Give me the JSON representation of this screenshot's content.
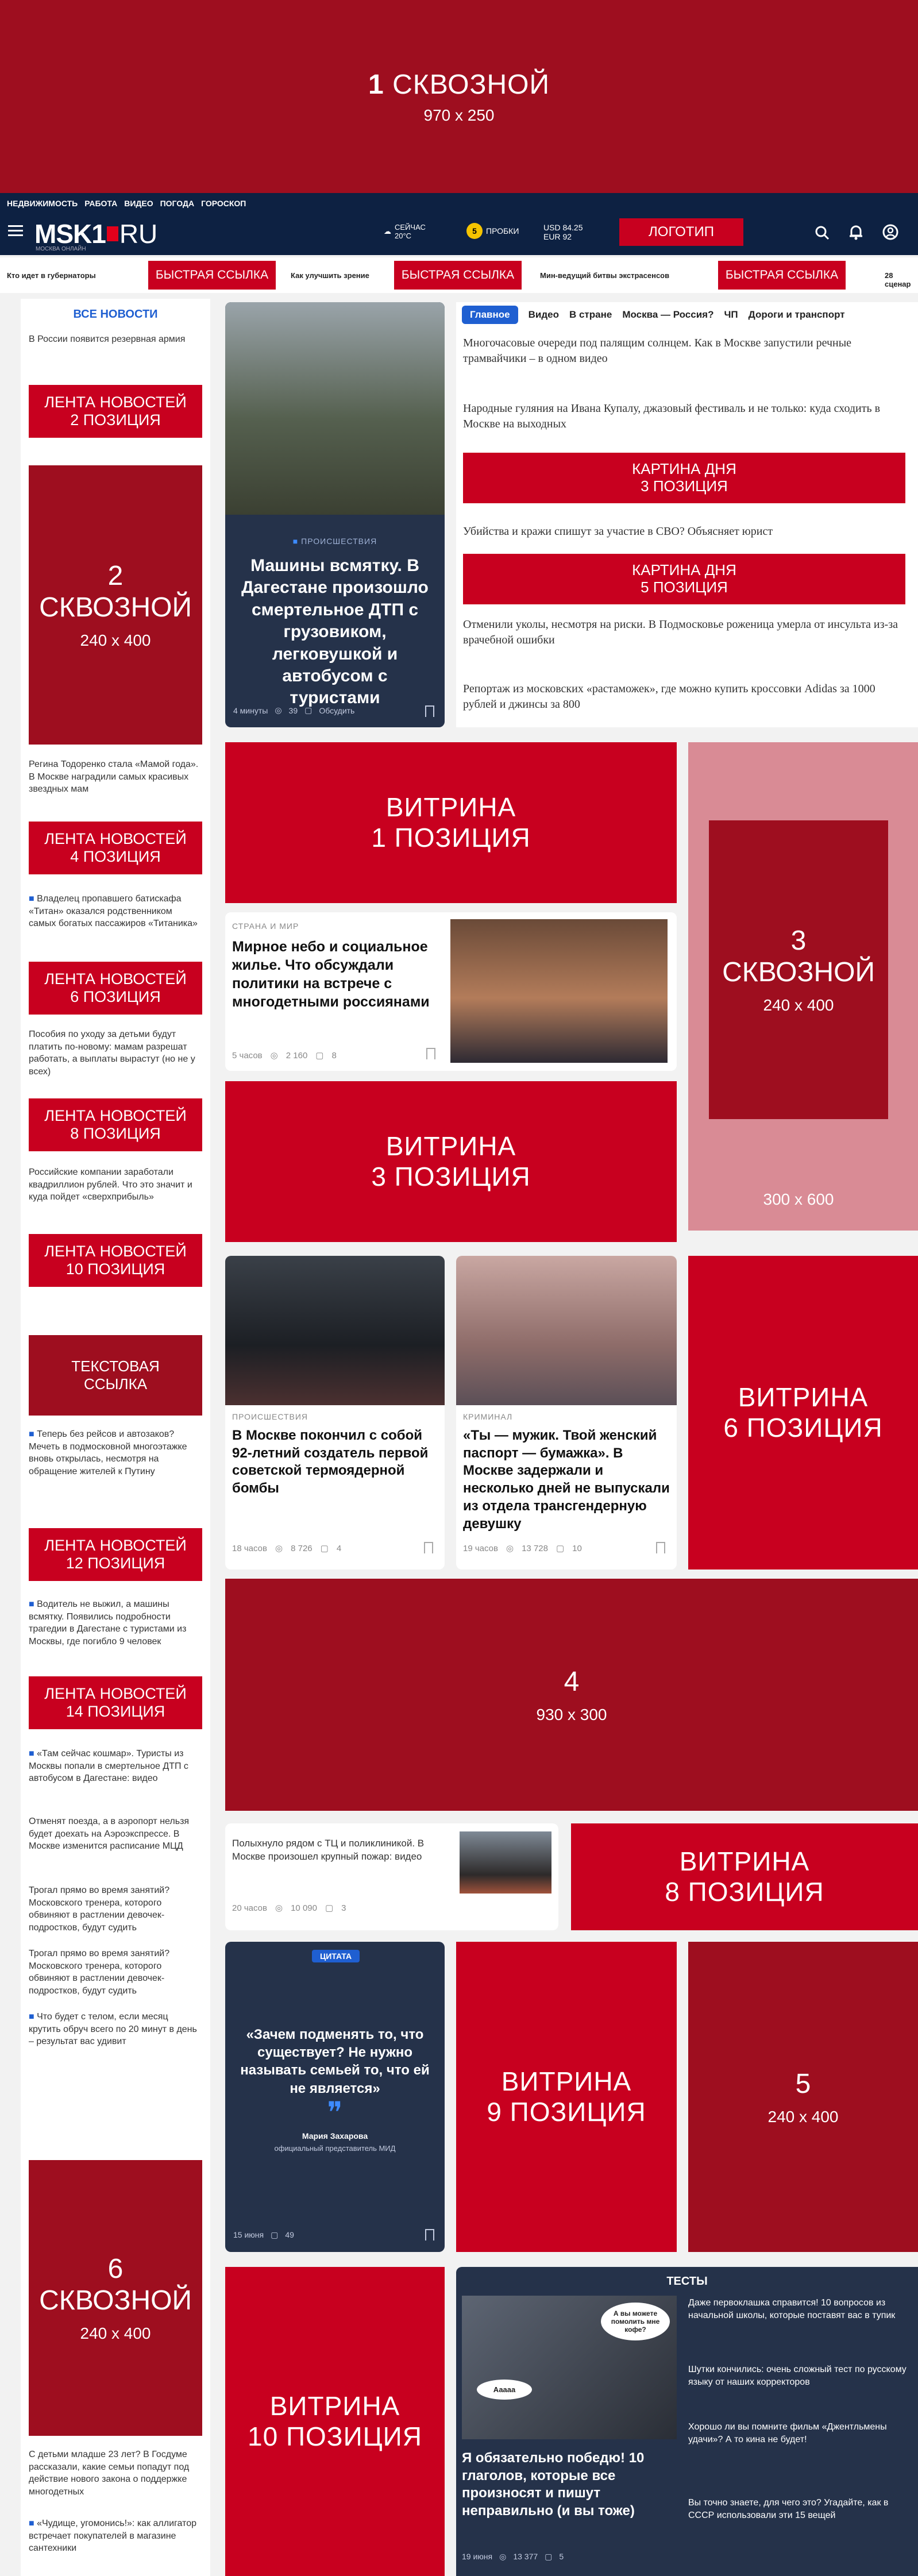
{
  "top_banner": {
    "num": "1",
    "title": "СКВОЗНОЙ",
    "size": "970 x 250"
  },
  "nav": {
    "links": [
      "НЕДВИЖИМОСТЬ",
      "РАБОТА",
      "ВИДЕО",
      "ПОГОДА",
      "ГОРОСКОП"
    ],
    "logo": "MSK1",
    "logo_ru": "RU",
    "logo_sub": "МОСКВА ОНЛАЙН",
    "weather_label": "СЕЙЧАС",
    "weather_temp": "20°C",
    "traffic_num": "5",
    "traffic_label": "ПРОБКИ",
    "usd": "USD 84.25",
    "eur": "EUR 92",
    "logo_btn": "ЛОГОТИП"
  },
  "quick": {
    "items": [
      "Кто идет в губернаторы",
      "Как улучшить зрение",
      "Мин-ведущий битвы экстрасенсов",
      "28 сценар"
    ],
    "links": [
      "БЫСТРАЯ ССЫЛКА",
      "БЫСТРАЯ ССЫЛКА",
      "БЫСТРАЯ ССЫЛКА"
    ]
  },
  "left": {
    "title": "ВСЕ НОВОСТИ",
    "news1": "В России появится резервная армия",
    "lenta2": "ЛЕНТА НОВОСТЕЙ\n2 ПОЗИЦИЯ",
    "banner2_num": "2",
    "banner2_title": "СКВОЗНОЙ",
    "banner2_size": "240 x 400",
    "news2": "Регина Тодоренко стала «Мамой года». В Москве наградили самых красивых звездных мам",
    "lenta4": "ЛЕНТА НОВОСТЕЙ\n4 ПОЗИЦИЯ",
    "news3": "Владелец пропавшего батискафа «Титан» оказался родственником самых богатых пассажиров «Титаника»",
    "lenta6": "ЛЕНТА НОВОСТЕЙ\n6 ПОЗИЦИЯ",
    "news4": "Пособия по уходу за детьми будут платить по-новому: мамам разрешат работать, а выплаты вырастут (но не у всех)",
    "lenta8": "ЛЕНТА НОВОСТЕЙ\n8 ПОЗИЦИЯ",
    "news5": "Российские компании заработали квадриллион рублей. Что это значит и куда пойдет «сверхприбыль»",
    "lenta10": "ЛЕНТА НОВОСТЕЙ\n10 ПОЗИЦИЯ",
    "text_link": "ТЕКСТОВАЯ\nССЫЛКА",
    "news6": "Теперь без рейсов и автозаков? Мечеть в подмосковной многоэтажке вновь открылась, несмотря на обращение жителей к Путину",
    "lenta12": "ЛЕНТА НОВОСТЕЙ\n12 ПОЗИЦИЯ",
    "news7": "Водитель не выжил, а машины всмятку. Появились подробности трагедии в Дагестане с туристами из Москвы, где погибло 9 человек",
    "lenta14": "ЛЕНТА НОВОСТЕЙ\n14 ПОЗИЦИЯ",
    "news8": "«Там сейчас кошмар». Туристы из Москвы попали в смертельное ДТП с автобусом в Дагестане: видео",
    "news9": "Отменят поезда, а в аэропорт нельзя будет доехать на Аэроэкспрессе. В Москве изменится расписание МЦД",
    "news10": "Трогал прямо во время занятий? Московского тренера, которого обвиняют в растлении девочек-подростков, будут судить",
    "news11": "Трогал прямо во время занятий? Московского тренера, которого обвиняют в растлении девочек-подростков, будут судить",
    "news12": "Что будет с телом, если месяц крутить обруч всего по 20 минут в день – результат вас удивит",
    "banner6_num": "6",
    "banner6_title": "СКВОЗНОЙ",
    "banner6_size": "240 x 400",
    "news13": "С детьми младше 23 лет? В Госдуме рассказали, какие семьи попадут под действие нового закона о поддержке многодетных",
    "news14": "«Чудище, угомонись!»: как аллигатор встречает покупателей в магазине сантехники"
  },
  "main_card": {
    "category": "ПРОИСШЕСТВИЯ",
    "title": "Машины всмятку. В Дагестане произошло смертельное ДТП с грузовиком, легковушкой и автобусом с туристами",
    "time": "4 минуты",
    "views": "39",
    "comment": "Обсудить"
  },
  "tabs": [
    "Главное",
    "Видео",
    "В стране",
    "Москва — Россия?",
    "ЧП",
    "Дороги и транспорт"
  ],
  "headlines": [
    "Многочасовые очереди под палящим солнцем. Как в Москве запустили речные трамвайчики – в одном видео",
    "Народные гуляния на Ивана Купалу, джазовый фестиваль и не только: куда сходить в Москве на выходных",
    "Убийства и кражи спишут за участие в СВО? Объясняет юрист",
    "Отменили уколы, несмотря на риски. В Подмосковье роженица умерла от инсульта из-за врачебной ошибки",
    "Репортаж из московских «растаможек», где можно купить кроссовки Adidas за 1000 рублей и джинсы за 800"
  ],
  "kartina3": "КАРТИНА ДНЯ\n3 ПОЗИЦИЯ",
  "kartina5": "КАРТИНА ДНЯ\n5 ПОЗИЦИЯ",
  "vitrina1": "ВИТРИНА\n1 ПОЗИЦИЯ",
  "vitrina3": "ВИТРИНА\n3 ПОЗИЦИЯ",
  "vitrina6": "ВИТРИНА\n6 ПОЗИЦИЯ",
  "vitrina8": "ВИТРИНА\n8 ПОЗИЦИЯ",
  "vitrina9": "ВИТРИНА\n9 ПОЗИЦИЯ",
  "vitrina10": "ВИТРИНА\n10 ПОЗИЦИЯ",
  "banner3": {
    "num": "3",
    "title": "СКВОЗНОЙ",
    "size": "240 x 400",
    "outer": "300 x 600"
  },
  "banner4": {
    "num": "4",
    "size": "930 x 300"
  },
  "banner5": {
    "num": "5",
    "size": "240 x 400"
  },
  "politics": {
    "category": "СТРАНА И МИР",
    "title": "Мирное небо и социальное жилье. Что обсуждали политики на встрече с многодетными россиянами",
    "time": "5 часов",
    "views": "2 160",
    "comments": "8"
  },
  "card_a": {
    "category": "ПРОИСШЕСТВИЯ",
    "title": "В Москве покончил с собой 92-летний создатель первой советской термоядерной бомбы",
    "time": "18 часов",
    "views": "8 726",
    "comments": "4"
  },
  "card_b": {
    "category": "КРИМИНАЛ",
    "title": "«Ты — мужик. Твой женский паспорт — бумажка». В Москве задержали и несколько дней не выпускали из отдела трансгендерную девушку",
    "time": "19 часов",
    "views": "13 728",
    "comments": "10"
  },
  "card_c": {
    "title": "Полыхнуло рядом с ТЦ и поликлиникой. В Москве произошел крупный пожар: видео",
    "time": "20 часов",
    "views": "10 090",
    "comments": "3"
  },
  "quote": {
    "badge": "ЦИТАТА",
    "text": "«Зачем подменять то, что существует? Не нужно называть семьей то, что ей не является»",
    "author": "Мария Захарова",
    "role": "официальный представитель МИД",
    "time": "15 июня",
    "comments": "49"
  },
  "tests": {
    "title": "ТЕСТЫ",
    "main": "Я обязательно победю! 10 глаголов, которые все произносят и пишут неправильно (и вы тоже)",
    "time": "19 июня",
    "views": "13 377",
    "comments": "5",
    "bubble1": "А вы можете помолить мне кофе?",
    "bubble2": "Ааааа",
    "items": [
      "Даже первоклашка справится! 10 вопросов из начальной школы, которые поставят вас в тупик",
      "Шутки кончились: очень сложный тест по русскому языку от наших корректоров",
      "Хорошо ли вы помните фильм «Джентльмены удачи»? А то кина не будет!",
      "Вы точно знаете, для чего это? Угадайте, как в СССР использовали эти 15 вещей"
    ]
  }
}
